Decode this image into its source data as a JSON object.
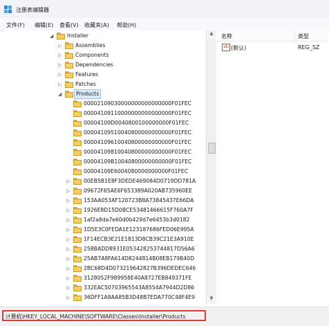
{
  "window": {
    "title": "注册表编辑器"
  },
  "menu": [
    "文件(F)",
    "编辑(E)",
    "查看(V)",
    "收藏夹(A)",
    "帮助(H)"
  ],
  "tree": {
    "parent": "Installer",
    "children": [
      "Assemblies",
      "Components",
      "Dependencies",
      "Features",
      "Patches"
    ],
    "selected": "Products",
    "products": [
      "00002109030000000000000000F01FEC",
      "00004109110000000000000000F01FEC",
      "00004109D0040800100000000F01FEC",
      "00004109510040800000000000F01FEC",
      "00004109610040800000000000F01FEC",
      "00004109810040800000000000F01FEC",
      "00004109B10040800000000000F01FEC",
      "00004109E6004080000000000F01FEC",
      "00EB5B1E8F3DEDE469084D0719DD781A",
      "09672F65AE6F653389A020AB735960EE",
      "153AA053AF120723B8A73845437E66DA",
      "1926E8D15D0BCE53481466615F760A7F",
      "1af2a8da7e60d0b429d7e6453b3d0182",
      "1D5E3C0FEDA1E123187686FED06E995A",
      "1F14ECB3E21E1813D8CB39C21E3A910E",
      "258BADD8931E053428253744817D56A6",
      "25AB7A8FA614D8244814B08EB179B40D",
      "2BC68D4D073219642827B396DEDEC646",
      "3128052F989958E40A8727EB849371FE",
      "332EAC50703965543A8554A7944D2D86",
      "36DFF1A8AA85B3D48B7EDA770C48F4E9"
    ]
  },
  "values": {
    "col_name": "名称",
    "col_type": "类型",
    "rows": [
      {
        "name": "(默认)",
        "type": "REG_SZ",
        "icon": "ab"
      }
    ]
  },
  "status": {
    "path": "计算机\\HKEY_LOCAL_MACHINE\\SOFTWARE\\Classes\\Installer\\Products"
  }
}
